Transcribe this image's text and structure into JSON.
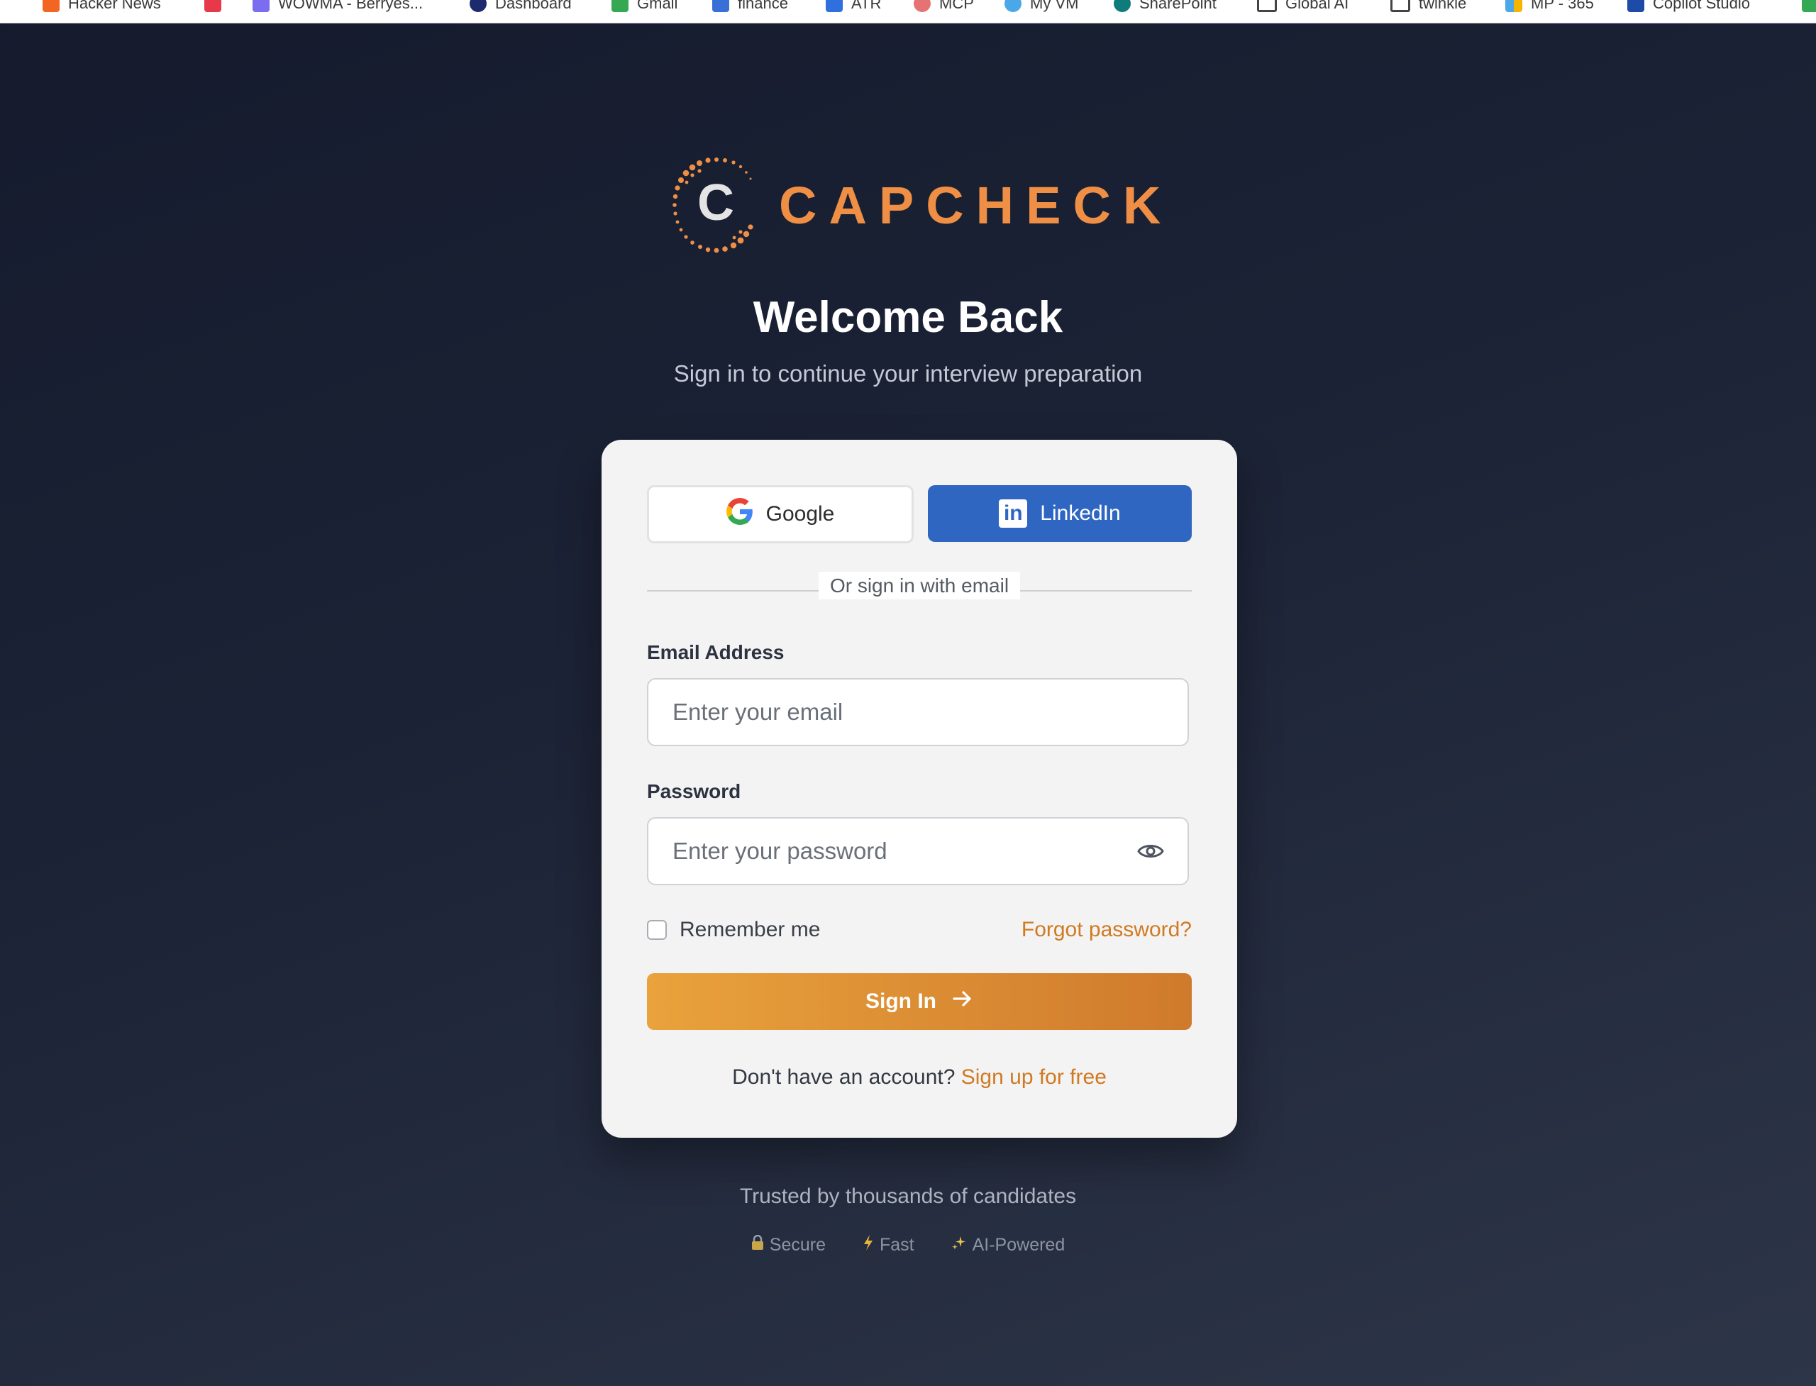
{
  "bookmarks": [
    {
      "label": "Hacker News",
      "icon": "hacker-news-icon",
      "color": "#f26522"
    },
    {
      "label": "",
      "icon": "youtube-icon",
      "color": "#e8394a"
    },
    {
      "label": "WOWMA - Berryes...",
      "icon": "wowma-icon",
      "color": "#7b6cf0"
    },
    {
      "label": "Dashboard",
      "icon": "dashboard-icon",
      "color": "#1e2a6e"
    },
    {
      "label": "Gmail",
      "icon": "gmail-icon",
      "color": "#34a853"
    },
    {
      "label": "finance",
      "icon": "finance-icon",
      "color": "#3b6fd8"
    },
    {
      "label": "ATR",
      "icon": "atr-icon",
      "color": "#2f6fde"
    },
    {
      "label": "MCP",
      "icon": "mcp-icon",
      "color": "#e57373"
    },
    {
      "label": "My VM",
      "icon": "vm-icon",
      "color": "#4aa8e8"
    },
    {
      "label": "SharePoint",
      "icon": "sharepoint-icon",
      "color": "#0f7b7a"
    },
    {
      "label": "Global AI",
      "icon": "folder-icon",
      "color": "#444444"
    },
    {
      "label": "twinkle",
      "icon": "folder-icon",
      "color": "#444444"
    },
    {
      "label": "MP - 365",
      "icon": "microsoft-icon",
      "color": "#f4b400"
    },
    {
      "label": "Copilot Studio",
      "icon": "copilot-icon",
      "color": "#1e4aa8"
    }
  ],
  "brand": {
    "name": "CAPCHECK",
    "mark_letter": "C",
    "accent_color": "#ee8f45"
  },
  "heading": {
    "title": "Welcome Back",
    "subtitle": "Sign in to continue your interview preparation"
  },
  "oauth": {
    "google_label": "Google",
    "linkedin_label": "LinkedIn",
    "linkedin_color": "#2f66c2"
  },
  "divider_text": "Or sign in with email",
  "form": {
    "email_label": "Email Address",
    "email_placeholder": "Enter your email",
    "email_value": "",
    "password_label": "Password",
    "password_placeholder": "Enter your password",
    "password_value": "",
    "remember_label": "Remember me",
    "remember_checked": false,
    "forgot_label": "Forgot password?",
    "submit_label": "Sign In",
    "link_color": "#d07a22"
  },
  "signup": {
    "prompt": "Don't have an account?",
    "link": "Sign up for free"
  },
  "footer": {
    "trusted_text": "Trusted by thousands of candidates",
    "badges": [
      {
        "icon": "lock-icon",
        "label": "Secure"
      },
      {
        "icon": "lightning-icon",
        "label": "Fast"
      },
      {
        "icon": "sparkle-icon",
        "label": "AI-Powered"
      }
    ]
  }
}
